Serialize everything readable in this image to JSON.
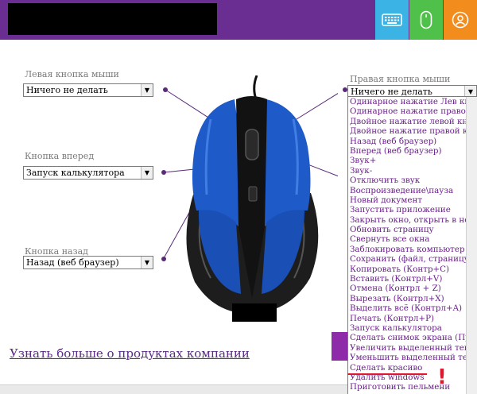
{
  "header": {
    "buttons": [
      {
        "icon": "keyboard-icon"
      },
      {
        "icon": "mouse-icon"
      },
      {
        "icon": "user-icon"
      }
    ],
    "colors": {
      "bar": "#6a2d91",
      "kbd": "#3bb3e5",
      "mouse": "#4fc14a",
      "user": "#f28c1c"
    }
  },
  "left_button": {
    "label": "Левая кнопка мыши",
    "value": "Ничего не делать"
  },
  "forward_button": {
    "label": "Кнопка вперед",
    "value": "Запуск калькулятора"
  },
  "back_button": {
    "label": "Кнопка назад",
    "value": "Назад (веб браузер)"
  },
  "right_button": {
    "label": "Правая кнопка мыши",
    "value": "Ничего не делать",
    "options": [
      "Одинарное нажатие Лев кнопки м",
      "Одинарное нажатие правой кноп",
      "Двойное нажатие левой кнопки м",
      "Двойное нажатие правой кнопки",
      "Назад (веб браузер)",
      "Вперед (веб браузер)",
      "Звук+",
      "Звук-",
      "Отключить звук",
      "Воспроизведение\\пауза",
      "Новый документ",
      "Запустить приложение",
      "Закрыть окно, открыть в новом о",
      "Обновить страницу",
      "Свернуть все окна",
      "Заблокировать компьютер",
      "Сохранить (файл, страницу)",
      "Копировать (Контр+C)",
      "Вставить (Контрл+V)",
      "Отмена (Контрл + Z)",
      "Вырезать (Контрл+X)",
      "Выделить всё (Контрл+A)",
      "Печать (Контрл+P)",
      "Запуск калькулятора",
      "Сделать снимок экрана (Принт С",
      "Увеличить выделенный текст",
      "Уменьшить выделенный текст",
      "Сделать красиво",
      "Удалить windows",
      "Приготовить пельмени"
    ]
  },
  "footer": {
    "link": "Узнать больше о продуктах компании"
  },
  "annotation": {
    "exclamation": "!"
  }
}
